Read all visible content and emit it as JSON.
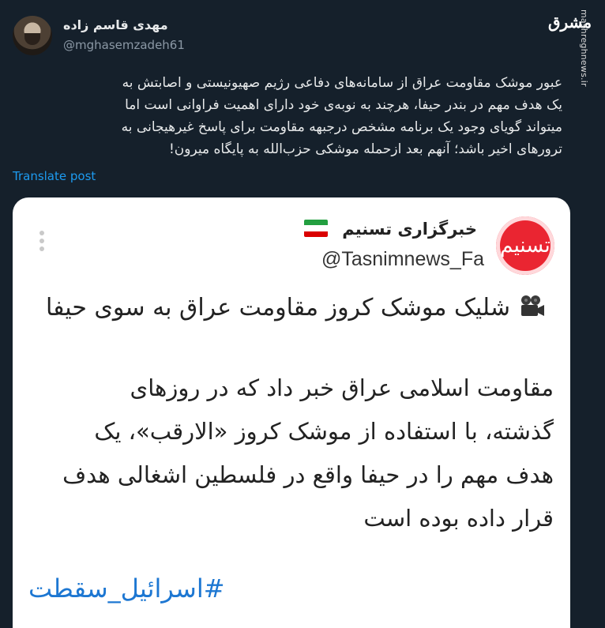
{
  "tweet": {
    "author_name": "مهدی قاسم زاده",
    "handle": "@mghasemzadeh61",
    "text_lines": [
      "عبور موشک مقاومت عراق از سامانه‌های دفاعی رژیم صهیونیستی و اصابتش به",
      "یک هدف مهم در بندر حیفا، هرچند به نوبه‌ی خود دارای اهمیت فراوانی است اما",
      "میتواند گویای وجود یک برنامه مشخص درجبهه مقاومت برای پاسخ غیرهیجانی به",
      "ترورهای اخیر باشد؛ آنهم بعد ازحمله موشکی حزب‌الله به پایگاه میرون!"
    ],
    "translate_label": "Translate post"
  },
  "watermark": {
    "logo_text": "مشرق",
    "url": "mashreghnews.ir"
  },
  "embedded_post": {
    "logo_text": "تسنیم",
    "account_name": "خبرگزاری تسنیم",
    "account_handle": "@Tasnimnews_Fa",
    "headline": "شلیک موشک کروز مقاومت عراق به سوی حیفا",
    "body_lines": [
      "مقاومت اسلامی عراق خبر داد که در روزهای",
      "گذشته، با استفاده از موشک کروز «الارقب»، یک",
      "هدف مهم را در حیفا واقع در فلسطین اشغالی هدف",
      "قرار داده بوده است"
    ],
    "hashtag": "#اسرائیل_سقطت",
    "headline_icon": "video-camera-icon",
    "flag_icon": "iran-flag-icon"
  },
  "colors": {
    "background": "#15202b",
    "link": "#1d9bf0",
    "hashtag": "#1d77d2",
    "tasnim_red": "#ea2531"
  }
}
